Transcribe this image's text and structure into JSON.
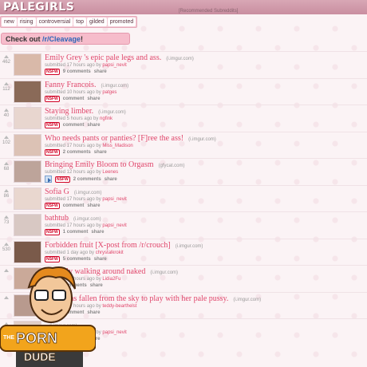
{
  "header": {
    "logo": "PALEGIRLS",
    "recommended": "[Recommended Subreddits]"
  },
  "tabs": [
    "new",
    "rising",
    "controversial",
    "top",
    "gilded",
    "promoted"
  ],
  "banner": {
    "prefix": "Check out ",
    "link": "/r/Cleavage",
    "suffix": "!"
  },
  "mascot": {
    "text1": "THE",
    "text2": "PORN",
    "text3": "DUDE"
  },
  "posts": [
    {
      "score": "462",
      "title": "Emily Grey 's epic pale legs and ass.",
      "domain": "(i.imgur.com)",
      "age": "submitted 17 hours ago by",
      "user": "papsi_nevit",
      "nsfw": "NSFW",
      "comments": "9 comments",
      "share": "share",
      "thumb": "#d9b9a9"
    },
    {
      "score": "112",
      "title": "Fanny Francois.",
      "domain": "(i.imgur.com)",
      "age": "submitted 10 hours ago by",
      "user": "patges",
      "nsfw": "NSFW",
      "comments": "comment",
      "share": "share",
      "thumb": "#8a6a58"
    },
    {
      "score": "40",
      "title": "Staying limber.",
      "domain": "(i.imgur.com)",
      "age": "submitted 5 hours ago by",
      "user": "ngfink",
      "nsfw": "NSFW",
      "comments": "comment",
      "share": "share",
      "thumb": "#e8d6cf"
    },
    {
      "score": "102",
      "title": "Who needs pants or panties? [F]ree the ass!",
      "domain": "(i.imgur.com)",
      "age": "submitted 17 hours ago by",
      "user": "Miss_Madison",
      "nsfw": "NSFW",
      "comments": "2 comments",
      "share": "share",
      "thumb": "#dcc2b5"
    },
    {
      "score": "68",
      "title": "Bringing Emily Bloom to Orgasm",
      "domain": "(gfycat.com)",
      "age": "submitted 12 hours ago by",
      "user": "Leenes",
      "nsfw": "NSFW",
      "comments": "2 comments",
      "share": "share",
      "thumb": "#bda49a",
      "video": true
    },
    {
      "score": "86",
      "title": "Sofia G",
      "domain": "(i.imgur.com)",
      "age": "submitted 17 hours ago by",
      "user": "papsi_nevit",
      "nsfw": "NSFW",
      "comments": "comment",
      "share": "share",
      "thumb": "#e9d7cf"
    },
    {
      "score": "73",
      "title": "bathtub",
      "domain": "(i.imgur.com)",
      "age": "submitted 17 hours ago by",
      "user": "papsi_nevit",
      "nsfw": "NSFW",
      "comments": "1 comment",
      "share": "share",
      "thumb": "#d8c8c3"
    },
    {
      "score": "530",
      "title": "Forbidden fruit [X-post from /r/crouch]",
      "domain": "(i.imgur.com)",
      "age": "submitted 1 day ago by",
      "user": "chrystalkrokit",
      "nsfw": "NSFW",
      "comments": "5 comments",
      "share": "share",
      "thumb": "#7a5a4a"
    },
    {
      "score": "",
      "title": "Casually walking around naked",
      "domain": "(i.imgur.com)",
      "age": "submitted 17 hours ago by",
      "user": "Lidia2Fu",
      "nsfw": "NSFW",
      "comments": "comments",
      "share": "share",
      "thumb": "#caa999"
    },
    {
      "score": "",
      "title": "Angel has fallen from the sky to play with her pale pussy.",
      "domain": "(i.imgur.com)",
      "age": "submitted 17 hours ago by",
      "user": "teddy-bearthelst",
      "nsfw": "NSFW",
      "comments": "comment",
      "share": "share",
      "thumb": "#b89a8e"
    },
    {
      "score": "",
      "title": "",
      "domain": "(i.imgur.com)",
      "age": "submitted 17 hours ago by",
      "user": "papsi_nevit",
      "nsfw": "NSFW",
      "comments": "comment",
      "share": "share",
      "thumb": "#e0cdc6"
    }
  ]
}
